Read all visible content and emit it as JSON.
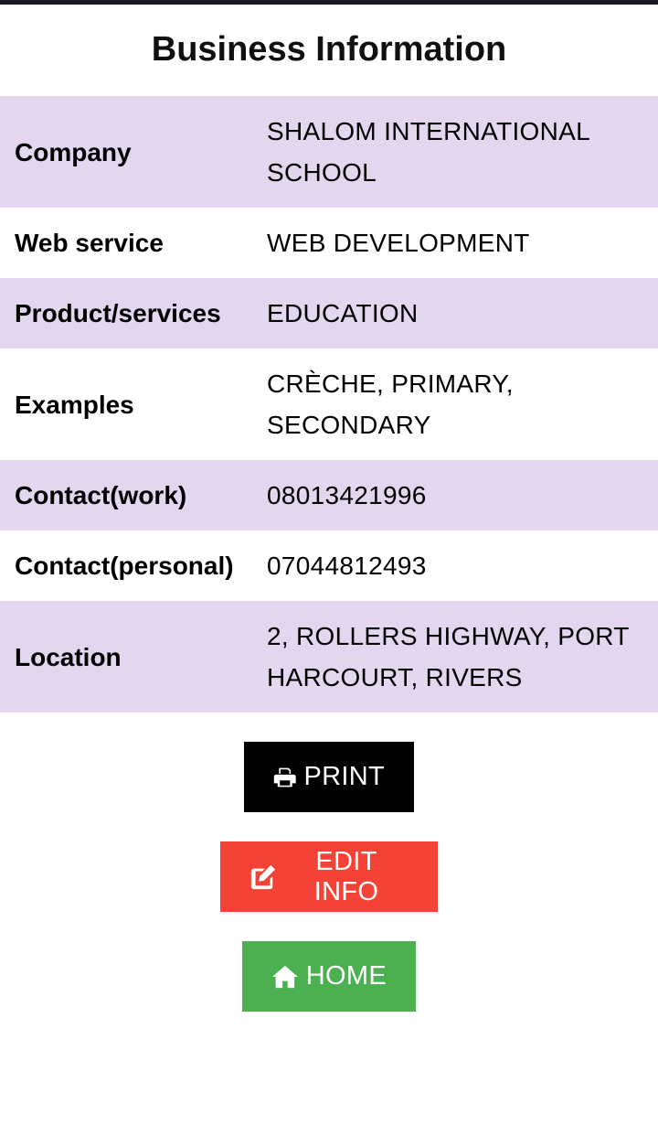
{
  "page": {
    "title": "Business Information"
  },
  "info_rows": [
    {
      "label": "Company",
      "value": "SHALOM INTERNATIONAL SCHOOL"
    },
    {
      "label": "Web service",
      "value": "WEB DEVELOPMENT"
    },
    {
      "label": "Product/services",
      "value": "EDUCATION"
    },
    {
      "label": "Examples",
      "value": "CRÈCHE, PRIMARY, SECONDARY"
    },
    {
      "label": "Contact(work)",
      "value": "08013421996"
    },
    {
      "label": "Contact(personal)",
      "value": "07044812493"
    },
    {
      "label": "Location",
      "value": "2, ROLLERS HIGHWAY, PORT HARCOURT, RIVERS"
    }
  ],
  "buttons": {
    "print": {
      "label": "PRINT",
      "icon": "print-icon",
      "color": "#000000"
    },
    "edit": {
      "label": "EDIT INFO",
      "icon": "edit-icon",
      "color": "#f44336"
    },
    "home": {
      "label": "HOME",
      "icon": "home-icon",
      "color": "#4caf50"
    }
  },
  "colors": {
    "row_alt": "#e3d6ef",
    "top_bar": "#1c1b22"
  }
}
